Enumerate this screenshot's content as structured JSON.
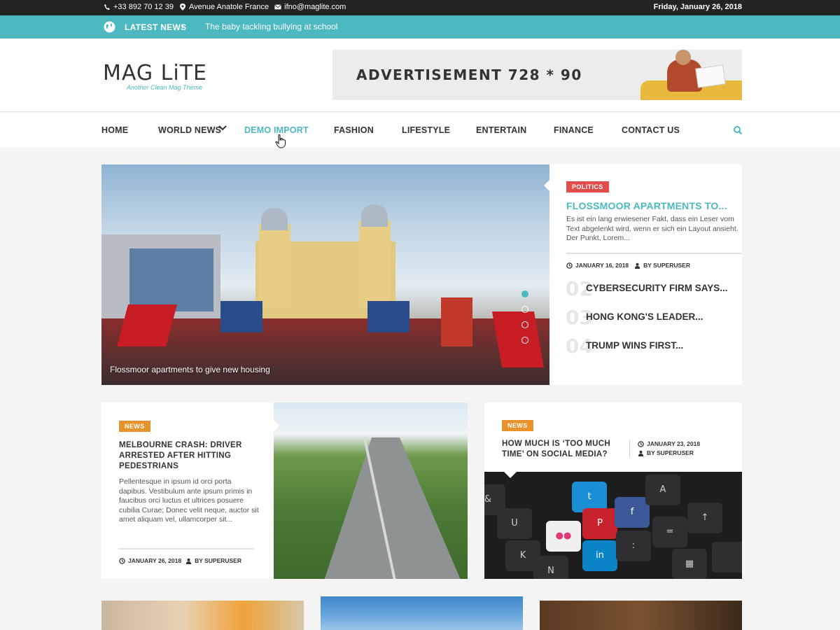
{
  "topbar": {
    "phone": "+33 892 70 12 39",
    "address": "Avenue Anatole France",
    "email": "ifno@maglite.com",
    "date": "Friday, January 26, 2018"
  },
  "latest": {
    "label": "LATEST NEWS",
    "headline": "The baby tackling bullying at school"
  },
  "logo": {
    "name": "MAG LiTE",
    "tagline": "Another Clean Mag Theme"
  },
  "ad": {
    "text": "ADVERTISEMENT 728 * 90"
  },
  "nav": {
    "items": [
      "HOME",
      "WORLD NEWS",
      "DEMO IMPORT",
      "FASHION",
      "LIFESTYLE",
      "ENTERTAIN",
      "FINANCE",
      "CONTACT US"
    ],
    "active": "DEMO IMPORT"
  },
  "hero": {
    "caption": "Flossmoor apartments to give new housing",
    "category": "POLITICS",
    "title": "FLOSSMOOR APARTMENTS TO...",
    "excerpt": "Es ist ein lang erwiesener Fakt, dass ein Leser vom Text abgelenkt wird, wenn er sich ein Layout ansieht. Der Punkt, Lorem...",
    "date": "JANUARY 16, 2018",
    "author": "BY SUPERUSER",
    "list": [
      {
        "num": "02",
        "title": "CYBERSECURITY FIRM SAYS..."
      },
      {
        "num": "03",
        "title": "HONG KONG'S LEADER..."
      },
      {
        "num": "04",
        "title": "TRUMP WINS FIRST..."
      }
    ]
  },
  "card_left": {
    "category": "NEWS",
    "title": "MELBOURNE CRASH: DRIVER ARRESTED AFTER HITTING PEDESTRIANS",
    "excerpt": "Pellentesque in ipsum id orci porta dapibus. Vestibulum ante ipsum primis in faucibus orci luctus et ultrices posuere cubilia Curae; Donec velit neque, auctor sit amet aliquam vel, ullamcorper sit...",
    "date": "JANUARY 26, 2018",
    "author": "BY SUPERUSER"
  },
  "card_right": {
    "category": "NEWS",
    "title": "HOW MUCH IS ‘TOO MUCH TIME’ ON SOCIAL MEDIA?",
    "date": "JANUARY 23, 2018",
    "author": "BY SUPERUSER"
  },
  "colors": {
    "accent": "#4cb8c0",
    "politics_badge": "#e44c4c",
    "news_badge": "#e8922c",
    "topbar": "#232323"
  }
}
